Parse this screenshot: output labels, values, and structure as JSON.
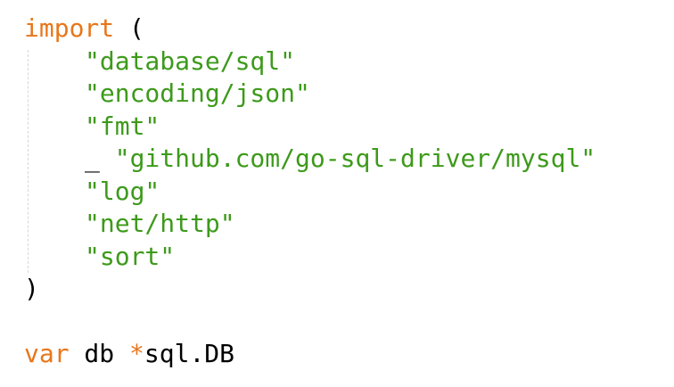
{
  "code": {
    "line1": {
      "keyword": "import",
      "paren": "("
    },
    "imports": [
      {
        "prefix": "",
        "path": "\"database/sql\""
      },
      {
        "prefix": "",
        "path": "\"encoding/json\""
      },
      {
        "prefix": "",
        "path": "\"fmt\""
      },
      {
        "prefix": "_ ",
        "path": "\"github.com/go-sql-driver/mysql\""
      },
      {
        "prefix": "",
        "path": "\"log\""
      },
      {
        "prefix": "",
        "path": "\"net/http\""
      },
      {
        "prefix": "",
        "path": "\"sort\""
      }
    ],
    "close_paren": ")",
    "var_line": {
      "keyword": "var",
      "name": " db ",
      "star": "*",
      "type": "sql.DB"
    }
  },
  "colors": {
    "keyword": "#e8761a",
    "string": "#3d9a1b",
    "text": "#000000",
    "background": "#ffffff"
  }
}
